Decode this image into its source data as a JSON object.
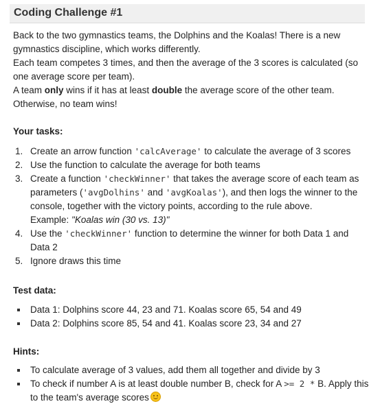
{
  "title": "Coding Challenge #1",
  "intro": {
    "p1": "Back to the two gymnastics teams, the Dolphins and the Koalas! There is a new gymnastics discipline, which works differently.",
    "p2": "Each team competes 3 times, and then the average of the 3 scores is calculated (so one average score per team).",
    "p3_pre": "A team ",
    "p3_b1": "only",
    "p3_mid": " wins if it has at least ",
    "p3_b2": "double",
    "p3_post": " the average score of the other team.",
    "p4": "Otherwise, no team wins!"
  },
  "tasks": {
    "heading": "Your tasks:",
    "t1": {
      "num": "1.",
      "pre": "Create an arrow function ",
      "code": "'calcAverage'",
      "post": " to calculate the average of 3 scores"
    },
    "t2": {
      "num": "2.",
      "text": "Use the function to calculate the average for both teams"
    },
    "t3": {
      "num": "3.",
      "pre": "Create a function ",
      "code1": "'checkWinner'",
      "mid1": " that takes the average score of each team as parameters (",
      "code2": "'avgDolhins'",
      "mid2": " and ",
      "code3": "'avgKoalas'",
      "post": "), and then logs the winner to the console, together with the victory points, according to the rule above.",
      "example_label": "Example: ",
      "example": "\"Koalas win (30 vs. 13)\""
    },
    "t4": {
      "num": "4.",
      "pre": "Use the ",
      "code": "'checkWinner'",
      "post": " function to determine the winner for both Data 1 and Data 2"
    },
    "t5": {
      "num": "5.",
      "text": "Ignore draws this time"
    }
  },
  "test_data": {
    "heading": "Test data:",
    "items": [
      "Data 1: Dolphins score 44, 23 and 71. Koalas score 65, 54 and 49",
      "Data 2: Dolphins score 85, 54 and 41. Koalas score 23, 34 and 27"
    ]
  },
  "hints": {
    "heading": "Hints:",
    "h1": "To calculate average of 3 values, add them all together and divide by 3",
    "h2_pre": "To check if number A is at least double number B, check for A ",
    "h2_code": ">= 2 *",
    "h2_post": " B. Apply this to the team's average scores",
    "emoji_icon": "wink-emoji-icon"
  }
}
